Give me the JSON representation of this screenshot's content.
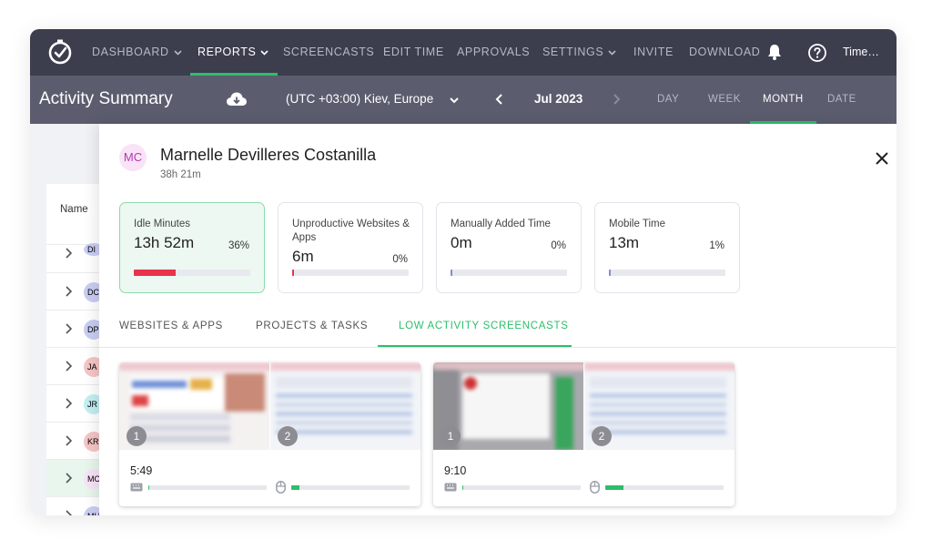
{
  "nav": {
    "items": [
      {
        "label": "DASHBOARD",
        "has_caret": true
      },
      {
        "label": "REPORTS",
        "has_caret": true,
        "active": true
      },
      {
        "label": "SCREENCASTS"
      },
      {
        "label": "EDIT TIME"
      },
      {
        "label": "APPROVALS"
      },
      {
        "label": "SETTINGS",
        "has_caret": true
      },
      {
        "label": "INVITE"
      },
      {
        "label": "DOWNLOAD"
      }
    ],
    "user_menu": "Time…",
    "icons": {
      "logo": "clock-check-logo",
      "bell": "bell-icon",
      "help": "help-icon"
    }
  },
  "subheader": {
    "title": "Activity Summary",
    "timezone": "(UTC +03:00) Kiev, Europe",
    "period_label": "Jul 2023",
    "periods": [
      "DAY",
      "WEEK",
      "MONTH",
      "DATE RANGE"
    ],
    "active_period": "MONTH"
  },
  "list": {
    "column_name": "Name",
    "rows": [
      {
        "initials": "DI",
        "color": "#c9cdf2"
      },
      {
        "initials": "DC",
        "color": "#c9cdf2"
      },
      {
        "initials": "DP",
        "color": "#c9cdf2"
      },
      {
        "initials": "JA",
        "color": "#f5c5c5"
      },
      {
        "initials": "JR",
        "color": "#c2eff2"
      },
      {
        "initials": "KR",
        "color": "#f5c5c5"
      },
      {
        "initials": "MC",
        "color": "#f8e3f7",
        "selected": true
      },
      {
        "initials": "MH",
        "color": "#c9cdf2"
      }
    ]
  },
  "panel": {
    "avatar_initials": "MC",
    "user_name": "Marnelle Devilleres Costanilla",
    "total_time": "38h 21m",
    "stats": [
      {
        "title": "Idle Minutes",
        "value": "13h 52m",
        "percent": "36%",
        "fraction": 0.36,
        "color": "#e8334a",
        "highlighted": true
      },
      {
        "title": "Unproductive Websites & Apps",
        "value": "6m",
        "percent": "0%",
        "fraction": 0.008,
        "color": "#e8334a"
      },
      {
        "title": "Manually Added Time",
        "value": "0m",
        "percent": "0%",
        "fraction": 0.0,
        "color": "#7f8cd8"
      },
      {
        "title": "Mobile Time",
        "value": "13m",
        "percent": "1%",
        "fraction": 0.01,
        "color": "#7f8cd8"
      }
    ],
    "tabs": [
      "WEBSITES & APPS",
      "PROJECTS & TASKS",
      "LOW ACTIVITY SCREENCASTS"
    ],
    "active_tab": "LOW ACTIVITY SCREENCASTS",
    "screencasts": [
      {
        "time": "5:49",
        "badges": [
          "1",
          "2"
        ],
        "keyboard_activity": 0.0,
        "mouse_activity": 0.07
      },
      {
        "time": "9:10",
        "badges": [
          "1",
          "2"
        ],
        "keyboard_activity": 0.01,
        "mouse_activity": 0.15
      }
    ]
  },
  "colors": {
    "accent": "#2ebd6b",
    "nav_bg": "#3c3d4d",
    "subheader_bg": "#5b5d6f",
    "danger": "#e8334a"
  }
}
